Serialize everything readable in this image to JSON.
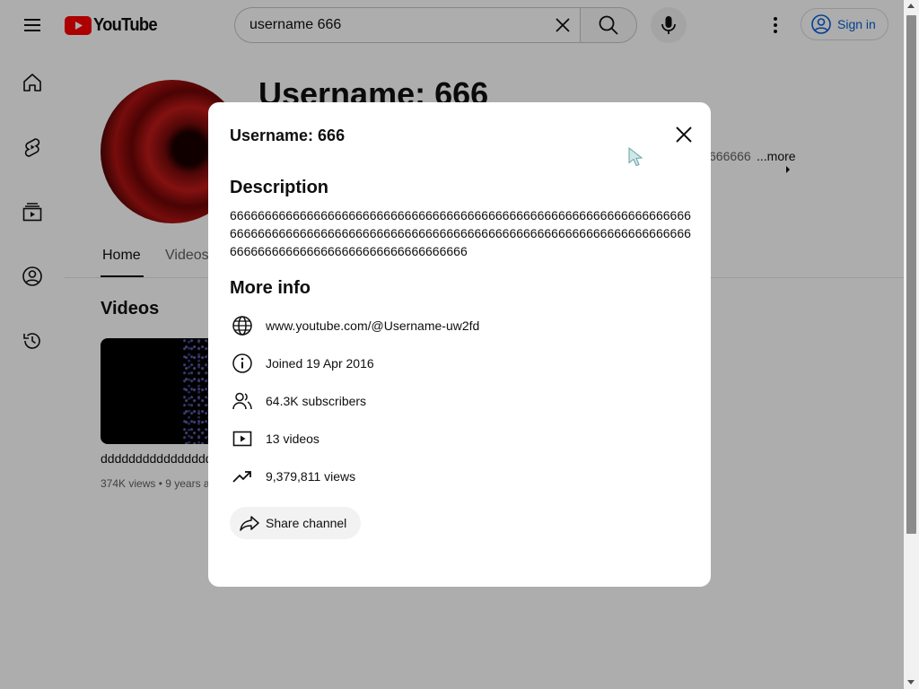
{
  "header": {
    "logo_text": "YouTube",
    "search_value": "username 666",
    "search_placeholder": "Search",
    "signin_label": "Sign in"
  },
  "guide": {
    "items": [
      {
        "icon": "home-icon"
      },
      {
        "icon": "shorts-icon"
      },
      {
        "icon": "subscriptions-icon"
      },
      {
        "icon": "you-icon"
      },
      {
        "icon": "history-icon"
      }
    ]
  },
  "channel": {
    "title": "Username: 666",
    "description_snippet": "666666",
    "more_label": "...more",
    "tabs": [
      "Home",
      "Videos"
    ],
    "section_title": "Videos",
    "video": {
      "title": "dddddddddddddddd",
      "meta": "374K views • 9 years a"
    }
  },
  "dialog": {
    "title": "Username: 666",
    "description_heading": "Description",
    "description": "6666666666666666666666666666666666666666666666666666666666666666666666666666666666666666666666666666666666666666666666666666666666666666666666666666666666666666666666",
    "more_info_heading": "More info",
    "info": [
      {
        "icon": "globe-icon",
        "text": "www.youtube.com/@Username-uw2fd"
      },
      {
        "icon": "info-icon",
        "text": "Joined 19 Apr 2016"
      },
      {
        "icon": "subscribers-icon",
        "text": "64.3K subscribers"
      },
      {
        "icon": "video-icon",
        "text": "13 videos"
      },
      {
        "icon": "trending-icon",
        "text": "9,379,811 views"
      }
    ],
    "share_label": "Share channel"
  },
  "colors": {
    "brand_red": "#ff0000",
    "link_blue": "#065fd4",
    "overlay": "rgba(0,0,0,0.32)"
  }
}
